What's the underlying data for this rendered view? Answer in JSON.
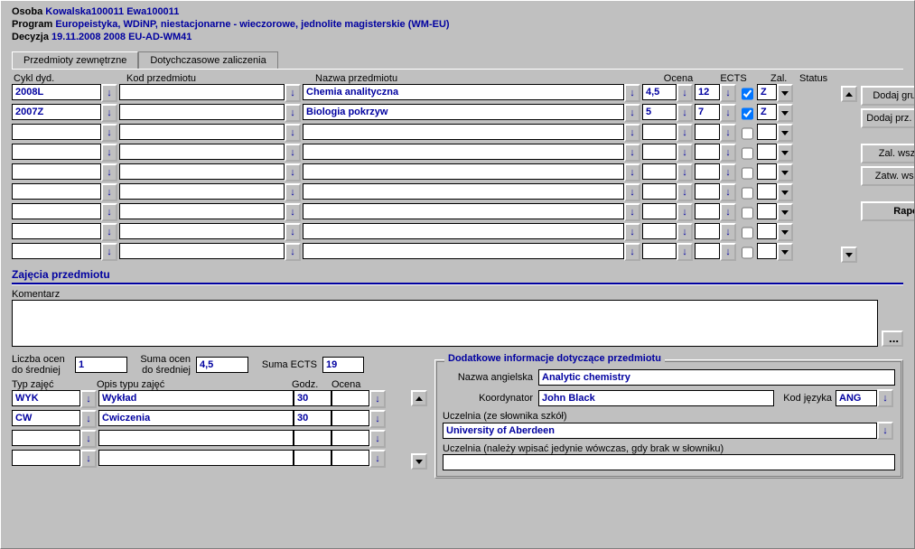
{
  "header": {
    "osoba_label": "Osoba",
    "osoba_value": "Kowalska100011 Ewa100011",
    "program_label": "Program",
    "program_value": "Europeistyka, WDiNP, niestacjonarne - wieczorowe, jednolite magisterskie (WM-EU)",
    "decyzja_label": "Decyzja",
    "decyzja_value": "19.11.2008   2008   EU-AD-WM41"
  },
  "tabs": {
    "t1": "Przedmioty zewnętrzne",
    "t2": "Dotychczasowe zaliczenia"
  },
  "grid": {
    "col_cykl": "Cykl dyd.",
    "col_kod": "Kod przedmiotu",
    "col_nazwa": "Nazwa przedmiotu",
    "col_ocena": "Ocena",
    "col_ects": "ECTS",
    "col_zal": "Zal.",
    "col_status": "Status",
    "rows": [
      {
        "cykl": "2008L",
        "kod": "",
        "nazwa": "Chemia analityczna",
        "ocena": "4,5",
        "ects": "12",
        "zal": true,
        "status": "Z"
      },
      {
        "cykl": "2007Z",
        "kod": "",
        "nazwa": "Biologia pokrzyw",
        "ocena": "5",
        "ects": "7",
        "zal": true,
        "status": "Z"
      },
      {
        "cykl": "",
        "kod": "",
        "nazwa": "",
        "ocena": "",
        "ects": "",
        "zal": false,
        "status": ""
      },
      {
        "cykl": "",
        "kod": "",
        "nazwa": "",
        "ocena": "",
        "ects": "",
        "zal": false,
        "status": ""
      },
      {
        "cykl": "",
        "kod": "",
        "nazwa": "",
        "ocena": "",
        "ects": "",
        "zal": false,
        "status": ""
      },
      {
        "cykl": "",
        "kod": "",
        "nazwa": "",
        "ocena": "",
        "ects": "",
        "zal": false,
        "status": ""
      },
      {
        "cykl": "",
        "kod": "",
        "nazwa": "",
        "ocena": "",
        "ects": "",
        "zal": false,
        "status": ""
      },
      {
        "cykl": "",
        "kod": "",
        "nazwa": "",
        "ocena": "",
        "ects": "",
        "zal": false,
        "status": ""
      },
      {
        "cykl": "",
        "kod": "",
        "nazwa": "",
        "ocena": "",
        "ects": "",
        "zal": false,
        "status": ""
      }
    ]
  },
  "sidebar": {
    "dodaj_grupe": "Dodaj grupę prz.",
    "dodaj_studenta": "Dodaj prz. studenta",
    "zal_wszystkie": "Zal. wszystkie",
    "zatw_wszystkie": "Zatw. wszystkie",
    "raport": "Raport"
  },
  "section": {
    "title": "Zajęcia przedmiotu"
  },
  "komentarz_label": "Komentarz",
  "komentarz_value": "",
  "ellipsis": "...",
  "bottom": {
    "liczba_ocen_label": "Liczba ocen do średniej",
    "liczba_ocen": "1",
    "suma_ocen_label": "Suma ocen do średniej",
    "suma_ocen": "4,5",
    "suma_ects_label": "Suma ECTS",
    "suma_ects": "19",
    "typ_label": "Typ zajęć",
    "opis_label": "Opis typu zajęć",
    "godz_label": "Godz.",
    "ocena_label": "Ocena",
    "rows": [
      {
        "typ": "WYK",
        "opis": "Wykład",
        "godz": "30",
        "ocena": ""
      },
      {
        "typ": "CW",
        "opis": "Ćwiczenia",
        "godz": "30",
        "ocena": "",
        "selected": true
      },
      {
        "typ": "",
        "opis": "",
        "godz": "",
        "ocena": ""
      },
      {
        "typ": "",
        "opis": "",
        "godz": "",
        "ocena": ""
      }
    ]
  },
  "fieldset": {
    "legend": "Dodatkowe informacje dotyczące przedmiotu",
    "nazwa_ang_label": "Nazwa angielska",
    "nazwa_ang": "Analytic chemistry",
    "koordynator_label": "Koordynator",
    "koordynator": "John Black",
    "kod_jezyka_label": "Kod języka",
    "kod_jezyka": "ANG",
    "uczelnia_slownik_label": "Uczelnia (ze słownika szkół)",
    "uczelnia_slownik": "University of Aberdeen",
    "uczelnia_brak_label": "Uczelnia (należy wpisać jedynie wówczas, gdy brak w słowniku)",
    "uczelnia_brak": ""
  }
}
